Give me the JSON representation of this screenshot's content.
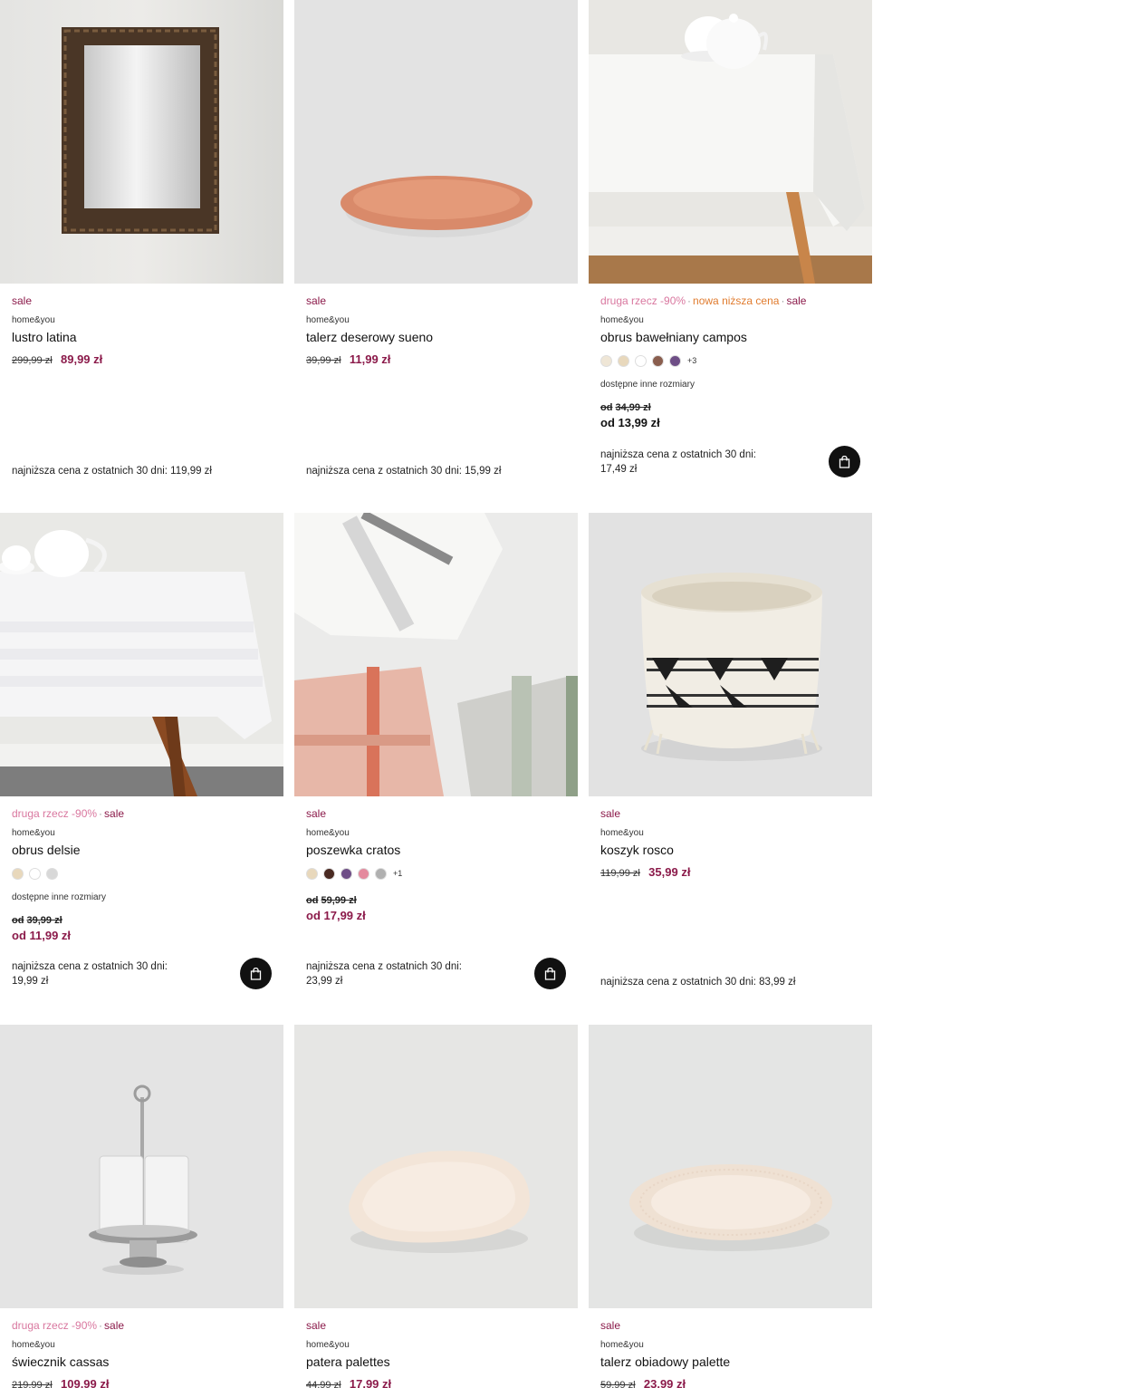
{
  "products": [
    {
      "badges": [
        {
          "text": "sale",
          "kind": "sale"
        }
      ],
      "brand": "home&you",
      "name": "lustro latina",
      "old_price": "299,99 zł",
      "new_price": "89,99 zł",
      "lowest": "najniższa cena z ostatnich 30 dni: 119,99 zł",
      "image": "mirror"
    },
    {
      "badges": [
        {
          "text": "sale",
          "kind": "sale"
        }
      ],
      "brand": "home&you",
      "name": "talerz deserowy sueno",
      "old_price": "39,99 zł",
      "new_price": "11,99 zł",
      "lowest": "najniższa cena z ostatnich 30 dni: 15,99 zł",
      "image": "terracotta-plate"
    },
    {
      "badges": [
        {
          "text": "druga rzecz -90%",
          "kind": "second"
        },
        {
          "text": "nowa niższa cena",
          "kind": "lower"
        },
        {
          "text": "sale",
          "kind": "sale"
        }
      ],
      "brand": "home&you",
      "name": "obrus bawełniany campos",
      "swatches": [
        "#efe6d6",
        "#e8d8bc",
        "#ffffff",
        "#8a5e4e",
        "#6e4e86"
      ],
      "swatches_more": "+3",
      "sizes_note": "dostępne inne rozmiary",
      "from_old_prefix": "od",
      "from_old": "34,99 zł",
      "from_new": "od 13,99 zł",
      "from_new_color": "#111111",
      "lowest_line1": "najniższa cena z ostatnich 30 dni:",
      "lowest_line2": "17,49 zł",
      "image": "tablecloth-teapots",
      "cart_icon": "shopping-bag-icon"
    },
    {
      "badges": [
        {
          "text": "druga rzecz -90%",
          "kind": "second"
        },
        {
          "text": "sale",
          "kind": "sale"
        }
      ],
      "brand": "home&you",
      "name": "obrus delsie",
      "swatches": [
        "#e8d8bc",
        "#ffffff",
        "#d8d8d8"
      ],
      "sizes_note": "dostępne inne rozmiary",
      "from_old_prefix": "od",
      "from_old": "39,99 zł",
      "from_new": "od 11,99 zł",
      "from_new_color": "#8b1a4a",
      "lowest_line1": "najniższa cena z ostatnich 30 dni:",
      "lowest_line2": "19,99 zł",
      "image": "tablecloth-teapot",
      "cart_icon": "shopping-bag-icon"
    },
    {
      "badges": [
        {
          "text": "sale",
          "kind": "sale"
        }
      ],
      "brand": "home&you",
      "name": "poszewka cratos",
      "swatches": [
        "#e8d8bc",
        "#4a2a22",
        "#6e4e86",
        "#e48a9e",
        "#b0b0b0"
      ],
      "swatches_more": "+1",
      "from_old_prefix": "od",
      "from_old": "59,99 zł",
      "from_new": "od 17,99 zł",
      "from_new_color": "#8b1a4a",
      "lowest_line1": "najniższa cena z ostatnich 30 dni:",
      "lowest_line2": "23,99 zł",
      "image": "pillows",
      "cart_icon": "shopping-bag-icon"
    },
    {
      "badges": [
        {
          "text": "sale",
          "kind": "sale"
        }
      ],
      "brand": "home&you",
      "name": "koszyk rosco",
      "old_price": "119,99 zł",
      "new_price": "35,99 zł",
      "lowest": "najniższa cena z ostatnich 30 dni: 83,99 zł",
      "image": "basket"
    },
    {
      "badges": [
        {
          "text": "druga rzecz -90%",
          "kind": "second"
        },
        {
          "text": "sale",
          "kind": "sale"
        }
      ],
      "brand": "home&you",
      "name": "świecznik cassas",
      "old_price": "219,99 zł",
      "new_price": "109,99 zł",
      "image": "candle-holder"
    },
    {
      "badges": [
        {
          "text": "sale",
          "kind": "sale"
        }
      ],
      "brand": "home&you",
      "name": "patera palettes",
      "old_price": "44,99 zł",
      "new_price": "17,99 zł",
      "image": "cream-platter"
    },
    {
      "badges": [
        {
          "text": "sale",
          "kind": "sale"
        }
      ],
      "brand": "home&you",
      "name": "talerz obiadowy palette",
      "old_price": "59,99 zł",
      "new_price": "23,99 zł",
      "image": "dinner-plate"
    }
  ]
}
